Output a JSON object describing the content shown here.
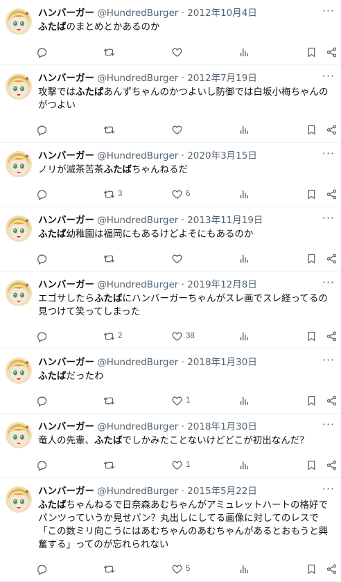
{
  "colors": {
    "text": "#0f1419",
    "muted": "#536471",
    "divider": "#eff3f4"
  },
  "icons": {
    "reply": "reply-icon",
    "retweet": "retweet-icon",
    "like": "heart-icon",
    "views": "views-icon",
    "bookmark": "bookmark-icon",
    "share": "share-icon",
    "more": "more-icon"
  },
  "tweets": [
    {
      "name": "ハンバーガー",
      "handle": "@HundredBurger",
      "sep": "·",
      "date": "2012年10月4日",
      "text_parts": [
        {
          "b": true,
          "t": "ふたば"
        },
        {
          "b": false,
          "t": "のまとめとかあるのか"
        }
      ],
      "retweets": "",
      "likes": ""
    },
    {
      "name": "ハンバーガー",
      "handle": "@HundredBurger",
      "sep": "·",
      "date": "2012年7月19日",
      "text_parts": [
        {
          "b": false,
          "t": "攻撃では"
        },
        {
          "b": true,
          "t": "ふたば"
        },
        {
          "b": false,
          "t": "あんずちゃんのかつよいし防御では白坂小梅ちゃんのがつよい"
        }
      ],
      "retweets": "",
      "likes": ""
    },
    {
      "name": "ハンバーガー",
      "handle": "@HundredBurger",
      "sep": "·",
      "date": "2020年3月15日",
      "text_parts": [
        {
          "b": false,
          "t": "ノリが滅茶苦茶"
        },
        {
          "b": true,
          "t": "ふたば"
        },
        {
          "b": false,
          "t": "ちゃんねるだ"
        }
      ],
      "retweets": "3",
      "likes": "6"
    },
    {
      "name": "ハンバーガー",
      "handle": "@HundredBurger",
      "sep": "·",
      "date": "2013年11月19日",
      "text_parts": [
        {
          "b": true,
          "t": "ふたば"
        },
        {
          "b": false,
          "t": "幼稚園は福岡にもあるけどよそにもあるのか"
        }
      ],
      "retweets": "",
      "likes": ""
    },
    {
      "name": "ハンバーガー",
      "handle": "@HundredBurger",
      "sep": "·",
      "date": "2019年12月8日",
      "text_parts": [
        {
          "b": false,
          "t": "エゴサしたら"
        },
        {
          "b": true,
          "t": "ふたば"
        },
        {
          "b": false,
          "t": "にハンバーガーちゃんがスレ画でスレ経ってるの見つけて笑ってしまった"
        }
      ],
      "retweets": "2",
      "likes": "38"
    },
    {
      "name": "ハンバーガー",
      "handle": "@HundredBurger",
      "sep": "·",
      "date": "2018年1月30日",
      "text_parts": [
        {
          "b": true,
          "t": "ふたば"
        },
        {
          "b": false,
          "t": "だったわ"
        }
      ],
      "retweets": "",
      "likes": "1"
    },
    {
      "name": "ハンバーガー",
      "handle": "@HundredBurger",
      "sep": "·",
      "date": "2018年1月30日",
      "text_parts": [
        {
          "b": false,
          "t": "竜人の先輩、"
        },
        {
          "b": true,
          "t": "ふたば"
        },
        {
          "b": false,
          "t": "でしかみたことないけどどこが初出なんだ？"
        }
      ],
      "retweets": "",
      "likes": "1"
    },
    {
      "name": "ハンバーガー",
      "handle": "@HundredBurger",
      "sep": "·",
      "date": "2015年5月22日",
      "text_parts": [
        {
          "b": true,
          "t": "ふたば"
        },
        {
          "b": false,
          "t": "ちゃんねるで日奈森あむちゃんがアミュレットハートの格好でパンツっていうか見せパン？丸出しにしてる画像に対してのレスで「この数ミリ向こうにはあむちゃんのあむちゃんがあるとおもうと興奮する」ってのが忘れられない"
        }
      ],
      "retweets": "",
      "likes": "5"
    }
  ]
}
